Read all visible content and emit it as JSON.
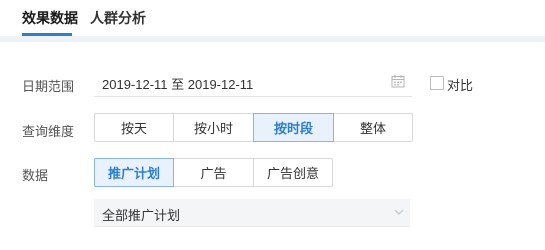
{
  "tabs": [
    {
      "label": "效果数据",
      "active": true
    },
    {
      "label": "人群分析",
      "active": false
    }
  ],
  "filters": {
    "date_range": {
      "label": "日期范围",
      "value": "2019-12-11 至 2019-12-11",
      "icon": "calendar-icon"
    },
    "compare": {
      "label": "对比",
      "checked": false
    },
    "dimension": {
      "label": "查询维度",
      "options": [
        "按天",
        "按小时",
        "按时段",
        "整体"
      ],
      "selected": "按时段"
    },
    "data": {
      "label": "数据",
      "options": [
        "推广计划",
        "广告",
        "广告创意"
      ],
      "selected": "推广计划"
    },
    "plan_select": {
      "value": "全部推广计划",
      "icon": "chevron-down-icon"
    }
  },
  "colors": {
    "accent": "#2a7fd4",
    "active_bg": "#e9f2fc",
    "band": "#eef1f6"
  }
}
